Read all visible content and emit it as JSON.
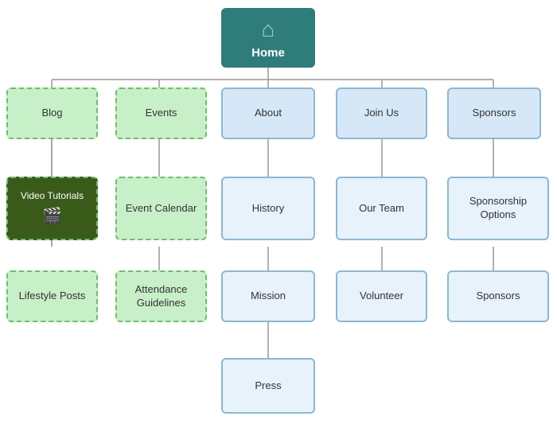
{
  "nodes": {
    "home": {
      "label": "Home",
      "icon": "🏠"
    },
    "blog": {
      "label": "Blog"
    },
    "events": {
      "label": "Events"
    },
    "about": {
      "label": "About"
    },
    "join_us": {
      "label": "Join Us"
    },
    "sponsors": {
      "label": "Sponsors"
    },
    "video_tutorials": {
      "label": "Video Tutorials",
      "icon": "🎬"
    },
    "lifestyle_posts": {
      "label": "Lifestyle Posts"
    },
    "event_calendar": {
      "label": "Event Calendar"
    },
    "attendance_guidelines": {
      "label": "Attendance Guidelines"
    },
    "history": {
      "label": "History"
    },
    "mission": {
      "label": "Mission"
    },
    "press": {
      "label": "Press"
    },
    "our_team": {
      "label": "Our Team"
    },
    "volunteer": {
      "label": "Volunteer"
    },
    "sponsorship_options": {
      "label": "Sponsorship Options"
    },
    "sponsors_sub": {
      "label": "Sponsors"
    }
  }
}
